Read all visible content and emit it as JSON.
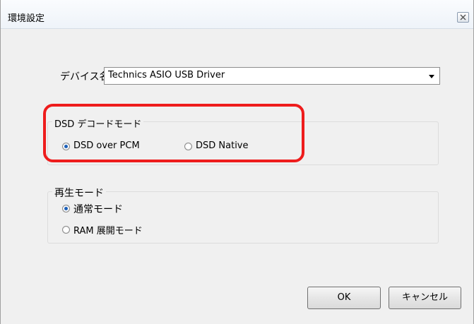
{
  "window": {
    "title": "環境設定",
    "close_icon": "close-icon"
  },
  "device": {
    "label": "デバイス名",
    "selected": "Technics ASIO USB Driver"
  },
  "dsd_group": {
    "title": "DSD デコードモード",
    "options": [
      {
        "label": "DSD over PCM",
        "checked": true
      },
      {
        "label": "DSD Native",
        "checked": false
      }
    ],
    "highlight_color": "#ee1c1c"
  },
  "play_group": {
    "title": "再生モード",
    "options": [
      {
        "label": "通常モード",
        "checked": true
      },
      {
        "label": "RAM 展開モード",
        "checked": false
      }
    ]
  },
  "buttons": {
    "ok": "OK",
    "cancel": "キャンセル"
  }
}
